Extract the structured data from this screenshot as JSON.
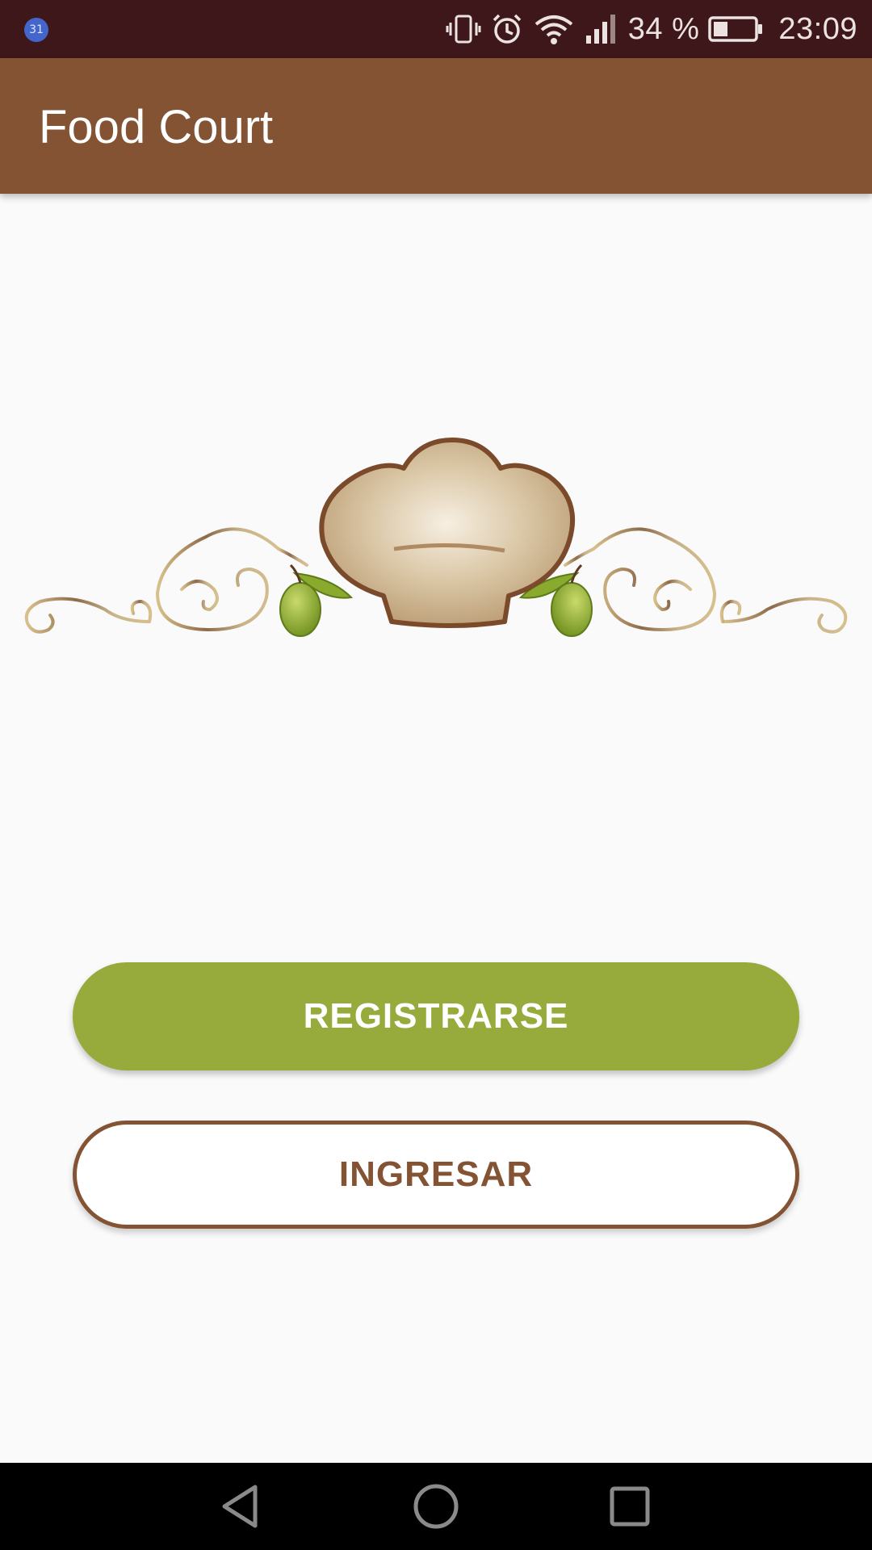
{
  "status_bar": {
    "notification_badge": "31",
    "notification_icon": "calendar-notification-icon",
    "icons": [
      "vibrate-icon",
      "alarm-icon",
      "wifi-icon",
      "signal-icon"
    ],
    "battery_percent": "34 %",
    "battery_level": 0.34,
    "time": "23:09",
    "background_color": "#3e171a"
  },
  "app_bar": {
    "title": "Food Court",
    "background_color": "#835333"
  },
  "logo": {
    "description_icon": "chef-hat-ornament-icon",
    "hat_color": "#d9c6a6",
    "olive_color": "#8aaa2d"
  },
  "buttons": {
    "register_label": "REGISTRARSE",
    "register_color": "#97ab3c",
    "login_label": "INGRESAR",
    "login_color": "#835333"
  },
  "nav_bar": {
    "back_icon": "back-triangle-icon",
    "home_icon": "home-circle-icon",
    "recent_icon": "recent-apps-square-icon"
  }
}
